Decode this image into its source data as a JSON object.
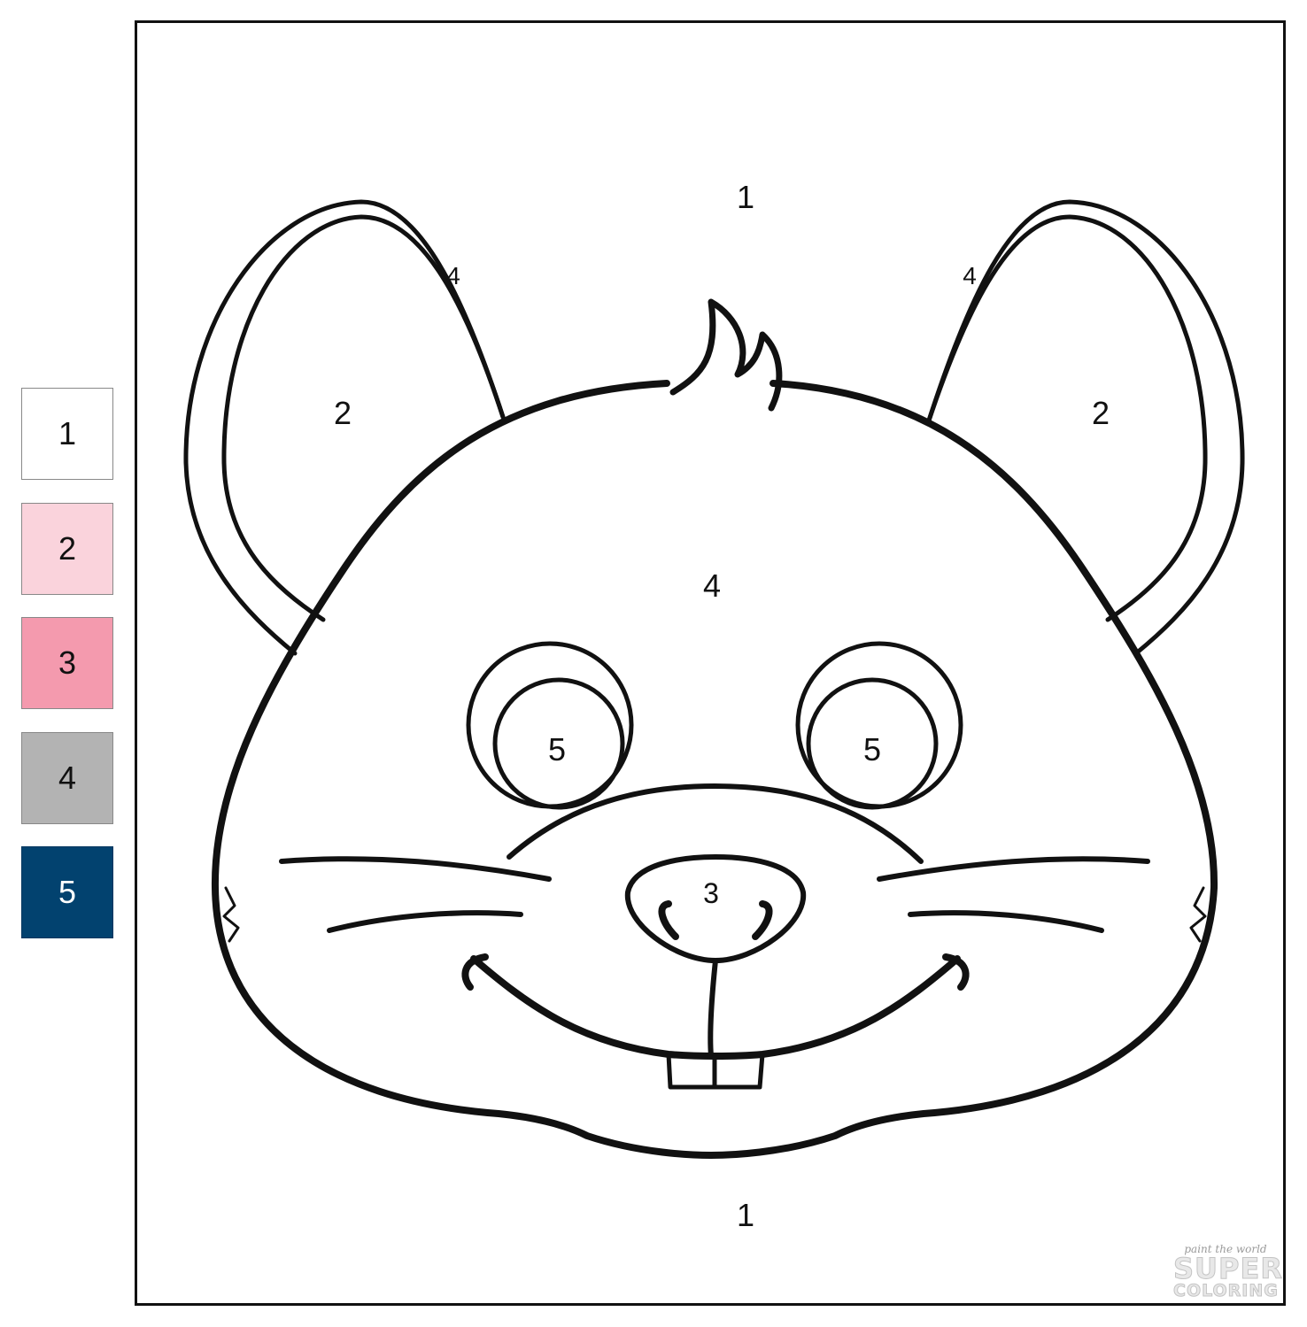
{
  "legend": [
    {
      "number": "1",
      "color": "#ffffff"
    },
    {
      "number": "2",
      "color": "#fad3dc"
    },
    {
      "number": "3",
      "color": "#f49aae"
    },
    {
      "number": "4",
      "color": "#b3b3b3"
    },
    {
      "number": "5",
      "color": "#02426f"
    }
  ],
  "regions": {
    "background_top": "1",
    "background_bottom": "1",
    "ear_rim_left": "4",
    "ear_rim_right": "4",
    "ear_inner_left": "2",
    "ear_inner_right": "2",
    "face": "4",
    "eye_left": "5",
    "eye_right": "5",
    "nose": "3"
  },
  "watermark": {
    "tagline": "paint the world",
    "line1": "SUPER",
    "line2": "COLORING"
  }
}
